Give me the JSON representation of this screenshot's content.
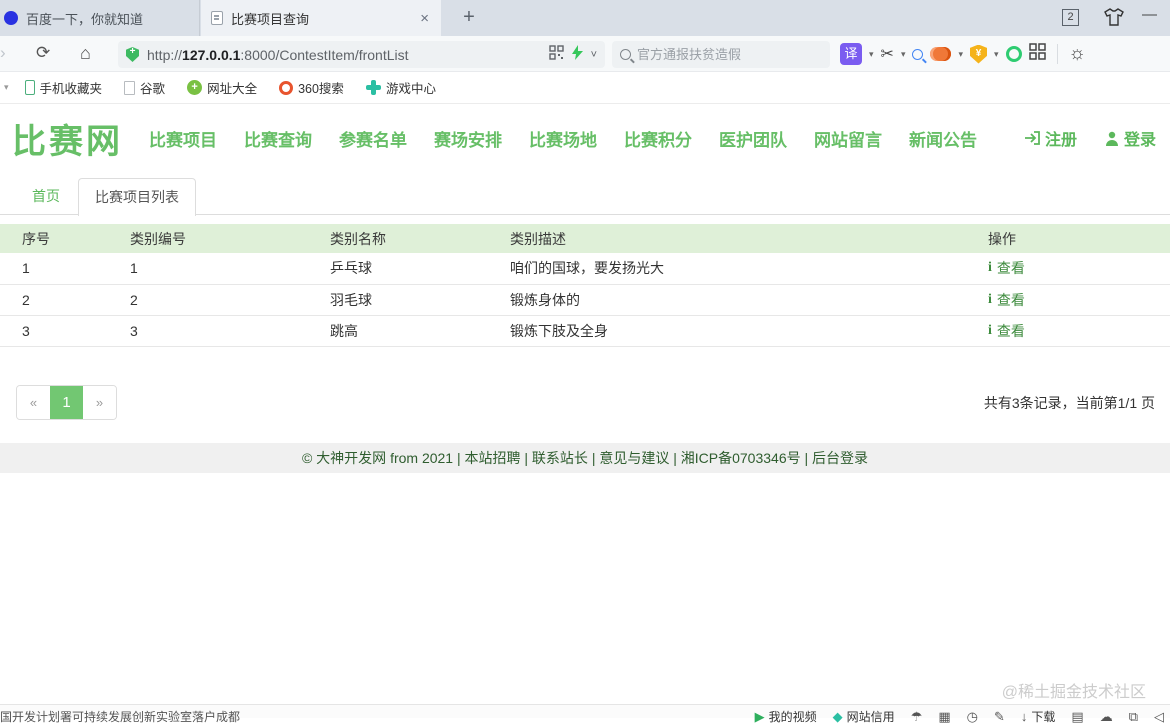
{
  "browser": {
    "tabs": [
      {
        "title": "百度一下，你就知道"
      },
      {
        "title": "比赛项目查询"
      }
    ],
    "tab_count_badge": "2",
    "url": {
      "scheme": "http://",
      "host": "127.0.0.1",
      "rest": ":8000/ContestItem/frontList"
    },
    "search_placeholder": "官方通报扶贫造假",
    "translate_label": "译",
    "bookmarks": [
      "手机收藏夹",
      "谷歌",
      "网址大全",
      "360搜索",
      "游戏中心"
    ]
  },
  "glyphs": {
    "close": "×",
    "plus": "+",
    "minimize": "—",
    "chevron": "›",
    "reload": "⟳",
    "home": "⌂",
    "caret_down": "▾",
    "url_caret": "˅",
    "scissors": "✂",
    "sun": "☼",
    "shield_yuan": "¥",
    "circle_plus": "+",
    "prev": "«",
    "next": "»",
    "info": "i"
  },
  "site": {
    "logo": "比赛网",
    "nav": [
      "比赛项目",
      "比赛查询",
      "参赛名单",
      "赛场安排",
      "比赛场地",
      "比赛积分",
      "医护团队",
      "网站留言",
      "新闻公告"
    ],
    "register": "注册",
    "login": "登录",
    "content_tabs": [
      {
        "label": "首页"
      },
      {
        "label": "比赛项目列表"
      }
    ],
    "table": {
      "headers": [
        "序号",
        "类别编号",
        "类别名称",
        "类别描述",
        "操作"
      ],
      "action_label": "查看",
      "rows": [
        {
          "seq": "1",
          "code": "1",
          "name": "乒乓球",
          "desc": "咱们的国球，要发扬光大"
        },
        {
          "seq": "2",
          "code": "2",
          "name": "羽毛球",
          "desc": "锻炼身体的"
        },
        {
          "seq": "3",
          "code": "3",
          "name": "跳高",
          "desc": "锻炼下肢及全身"
        }
      ]
    },
    "pagination": {
      "current": "1",
      "summary": "共有3条记录，当前第1/1 页"
    },
    "footer": "© 大神开发网 from 2021 | 本站招聘 | 联系站长 | 意见与建议 | 湘ICP备0703346号 | 后台登录"
  },
  "watermark": "@稀土掘金技术社区",
  "statusbar": {
    "ticker": "国开发计划署可持续发展创新实验室落户成都",
    "items": [
      {
        "glyph": "▶",
        "label": "我的视频"
      },
      {
        "glyph": "◆",
        "label": "网站信用"
      },
      {
        "glyph": "☂",
        "label": ""
      },
      {
        "glyph": "▦",
        "label": ""
      },
      {
        "glyph": "◷",
        "label": ""
      },
      {
        "glyph": "✎",
        "label": ""
      },
      {
        "glyph": "↓",
        "label": "下载"
      },
      {
        "glyph": "▤",
        "label": ""
      },
      {
        "glyph": "☁",
        "label": ""
      },
      {
        "glyph": "⧉",
        "label": ""
      },
      {
        "glyph": "◁",
        "label": ""
      }
    ]
  },
  "colors": {
    "accent_green": "#67bf67",
    "table_header_bg": "#dff0d8",
    "link_green": "#3d8b3d",
    "active_page_bg": "#72c772"
  }
}
